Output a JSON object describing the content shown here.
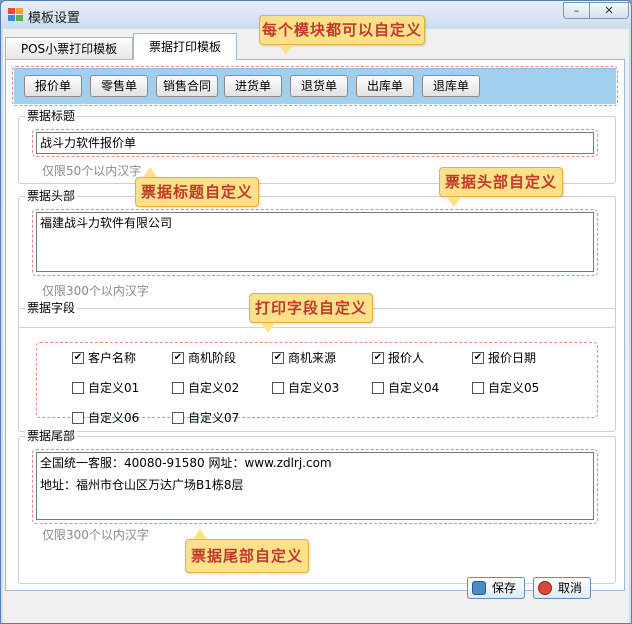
{
  "window": {
    "title": "模板设置",
    "minimize_glyph": "–",
    "close_glyph": "✕"
  },
  "tabs": [
    {
      "label": "POS小票打印模板",
      "active": false
    },
    {
      "label": "票据打印模板",
      "active": true
    }
  ],
  "toolbar": {
    "buttons": [
      "报价单",
      "零售单",
      "销售合同",
      "进货单",
      "退货单",
      "出库单",
      "退库单"
    ]
  },
  "title_group": {
    "legend": "票据标题",
    "value": "战斗力软件报价单",
    "hint": "仅限50个以内汉字"
  },
  "header_group": {
    "legend": "票据头部",
    "value": "福建战斗力软件有限公司",
    "hint": "仅限300个以内汉字"
  },
  "fields_group": {
    "legend": "票据字段",
    "checkboxes": [
      {
        "label": "客户名称",
        "checked": true
      },
      {
        "label": "商机阶段",
        "checked": true
      },
      {
        "label": "商机来源",
        "checked": true
      },
      {
        "label": "报价人",
        "checked": true
      },
      {
        "label": "报价日期",
        "checked": true
      },
      {
        "label": "自定义01",
        "checked": false
      },
      {
        "label": "自定义02",
        "checked": false
      },
      {
        "label": "自定义03",
        "checked": false
      },
      {
        "label": "自定义04",
        "checked": false
      },
      {
        "label": "自定义05",
        "checked": false
      },
      {
        "label": "自定义06",
        "checked": false
      },
      {
        "label": "自定义07",
        "checked": false
      }
    ],
    "check_glyph": "✔"
  },
  "footer_group": {
    "legend": "票据尾部",
    "line1": "全国统一客服：40080-91580    网址：www.zdlrj.com",
    "line2": "地址：福州市仓山区万达广场B1栋8层",
    "hint": "仅限300个以内汉字"
  },
  "callouts": {
    "modules": "每个模块都可以自定义",
    "title": "票据标题自定义",
    "header": "票据头部自定义",
    "fields": "打印字段自定义",
    "footer": "票据尾部自定义"
  },
  "actions": {
    "save": "保存",
    "cancel": "取消"
  },
  "colors": {
    "toolbar_strip": "#a3cfef",
    "callout_bg": "#fde18a",
    "callout_text": "#c0392b",
    "dashed_outline": "#e88a8a"
  },
  "icons": {
    "app": "app-window-icon",
    "save": "save-icon",
    "cancel": "cancel-icon"
  }
}
